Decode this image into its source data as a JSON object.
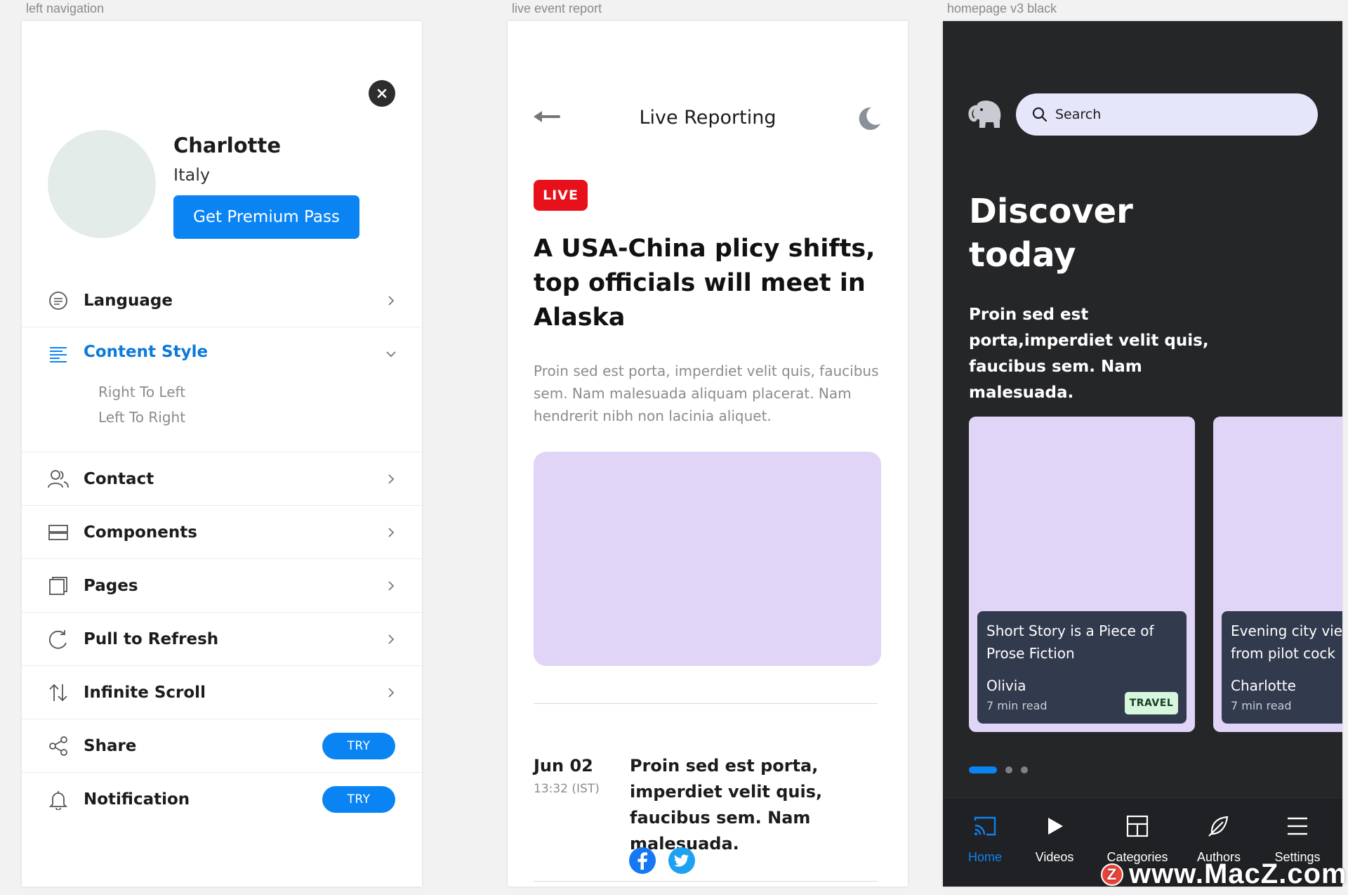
{
  "frames": {
    "left_navigation": "left navigation",
    "live_event_report": "live event report",
    "homepage_v3_black": "homepage v3 black"
  },
  "nav": {
    "profile": {
      "name": "Charlotte",
      "country": "Italy",
      "premium_label": "Get Premium Pass"
    },
    "menu": [
      {
        "label": "Language",
        "icon": "chat-bubble-icon"
      },
      {
        "label": "Content Style",
        "icon": "align-text-icon",
        "expanded": true,
        "sub": [
          "Right To Left",
          "Left To Right"
        ]
      },
      {
        "label": "Contact",
        "icon": "users-icon"
      },
      {
        "label": "Components",
        "icon": "layers-icon"
      },
      {
        "label": "Pages",
        "icon": "pages-icon"
      },
      {
        "label": "Pull to Refresh",
        "icon": "refresh-icon"
      },
      {
        "label": "Infinite Scroll",
        "icon": "sort-arrows-icon"
      },
      {
        "label": "Share",
        "icon": "share-icon",
        "badge": "TRY"
      },
      {
        "label": "Notification",
        "icon": "bell-icon",
        "badge": "TRY"
      }
    ],
    "accent": "#0b84f3"
  },
  "live": {
    "title": "Live Reporting",
    "badge": "LIVE",
    "headline": "A USA-China plicy shifts, top officials will meet in Alaska",
    "body": "Proin sed est porta, imperdiet velit quis, faucibus sem. Nam malesuada aliquam placerat. Nam hendrerit nibh non lacinia aliquet.",
    "update": {
      "date": "Jun 02",
      "time": "13:32 (IST)",
      "text": "Proin sed est porta, imperdiet velit quis, faucibus sem. Nam malesuada."
    },
    "live_color": "#e8101a"
  },
  "home": {
    "search_placeholder": "Search",
    "heading": "Discover today",
    "body": "Proin sed est porta,imperdiet velit quis, faucibus sem. Nam malesuada.",
    "cards": [
      {
        "title": "Short Story is a Piece of Prose Fiction",
        "author": "Olivia",
        "read": "7 min read",
        "tag": "TRAVEL"
      },
      {
        "title": "Evening city vie from pilot cock",
        "author": "Charlotte",
        "read": "7 min read"
      }
    ],
    "carousel_active": 1,
    "carousel_count": 3,
    "tabs": [
      {
        "label": "Home",
        "icon": "cast-icon",
        "active": true
      },
      {
        "label": "Videos",
        "icon": "play-icon"
      },
      {
        "label": "Categories",
        "icon": "grid-layout-icon"
      },
      {
        "label": "Authors",
        "icon": "feather-icon"
      },
      {
        "label": "Settings",
        "icon": "menu-lines-icon"
      }
    ]
  },
  "watermark": {
    "text": "www.MacZ.com",
    "badge": "Z"
  }
}
